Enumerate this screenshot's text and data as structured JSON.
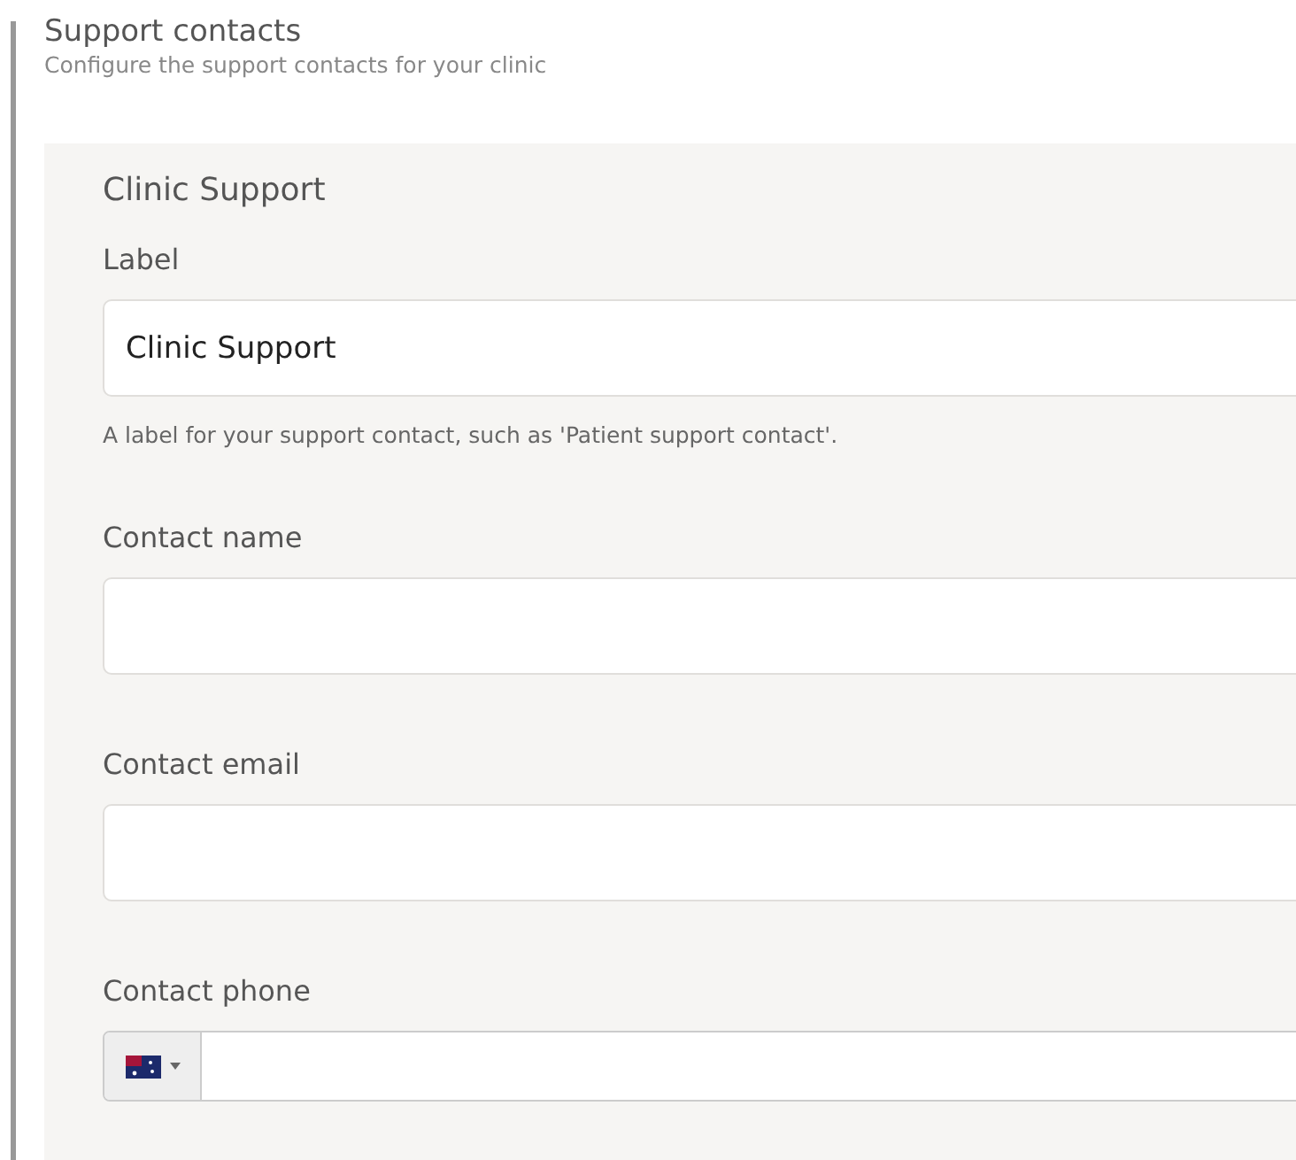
{
  "header": {
    "title": "Support contacts",
    "subtitle": "Configure the support contacts for your clinic"
  },
  "panel": {
    "title": "Clinic Support",
    "fields": [
      {
        "kind": "text",
        "label": "Label",
        "value": "Clinic Support",
        "help": "A label for your support contact, such as 'Patient support contact'."
      },
      {
        "kind": "text",
        "label": "Contact name"
      },
      {
        "kind": "text",
        "label": "Contact email"
      },
      {
        "kind": "phone",
        "label": "Contact phone"
      }
    ]
  }
}
